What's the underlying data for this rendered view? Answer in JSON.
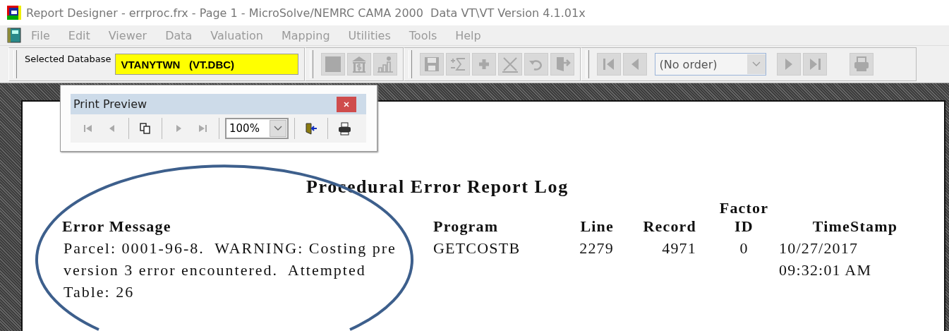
{
  "window": {
    "title": "Report Designer - errproc.frx - Page 1 - MicroSolve/NEMRC CAMA 2000  Data VT\\VT Version 4.1.01x"
  },
  "menu": [
    {
      "label": "File",
      "disabled": true
    },
    {
      "label": "Edit",
      "disabled": true
    },
    {
      "label": "Viewer",
      "disabled": true
    },
    {
      "label": "Data",
      "disabled": true
    },
    {
      "label": "Valuation",
      "disabled": true
    },
    {
      "label": "Mapping",
      "disabled": true
    },
    {
      "label": "Utilities",
      "disabled": true
    },
    {
      "label": "Tools",
      "disabled": true
    },
    {
      "label": "Help",
      "disabled": true
    }
  ],
  "toolbar": {
    "database_label": "Selected Database",
    "database_value": "VTANYTWN   (VT.DBC)",
    "order_combo": {
      "value": "(No order)"
    }
  },
  "print_preview": {
    "title": "Print Preview",
    "zoom_combo": {
      "value": "100%"
    }
  },
  "report": {
    "title": "Procedural Error Report Log",
    "columns": [
      "Error Message",
      "Program",
      "Line",
      "Record",
      "Factor ID",
      "TimeStamp"
    ],
    "rows": [
      {
        "error_message": "Parcel: 0001-96-8.  WARNING: Costing pre version 3 error encountered.  Attempted Table: 26",
        "program": "GETCOSTB",
        "line": "2279",
        "record": "4971",
        "factor_id": "0",
        "timestamp": "10/27/2017 09:32:01 AM"
      }
    ]
  }
}
